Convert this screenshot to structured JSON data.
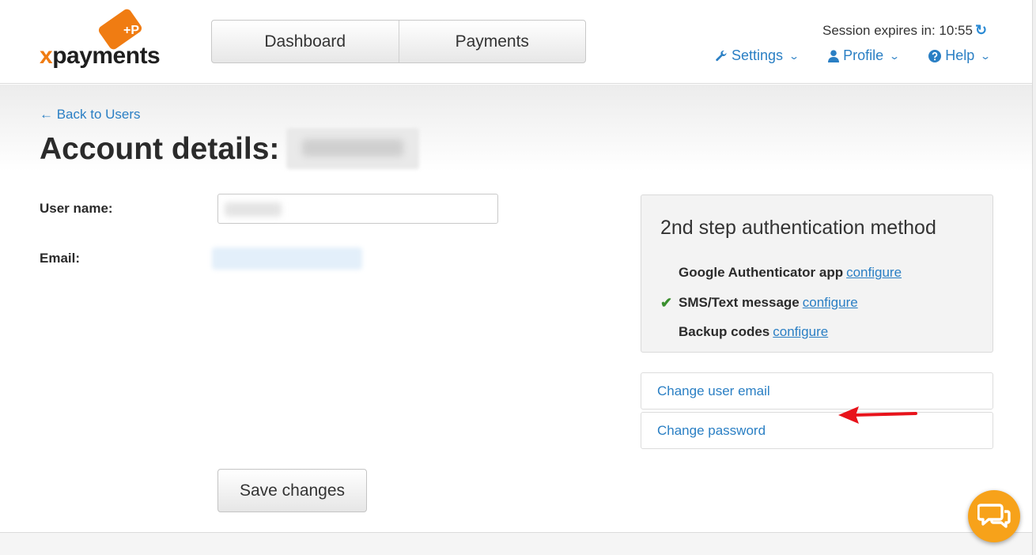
{
  "logo": {
    "text_x": "x",
    "text_rest": "payments",
    "card_mark": "+P"
  },
  "nav": {
    "tabs": [
      {
        "label": "Dashboard"
      },
      {
        "label": "Payments"
      }
    ]
  },
  "session": {
    "label": "Session expires in: 10:55",
    "icon": "refresh-icon"
  },
  "topmenu": {
    "settings": {
      "label": "Settings",
      "icon": "wrench-icon"
    },
    "profile": {
      "label": "Profile",
      "icon": "user-icon"
    },
    "help": {
      "label": "Help",
      "icon": "question-circle-icon"
    }
  },
  "page": {
    "back_link": "← Back to Users",
    "title": "Account details:",
    "fields": {
      "username_label": "User name:",
      "email_label": "Email:"
    },
    "save_label": "Save changes"
  },
  "auth": {
    "title": "2nd step authentication method",
    "methods": [
      {
        "name": "Google Authenticator app",
        "link": "configure",
        "active": false
      },
      {
        "name": "SMS/Text message",
        "link": "configure",
        "active": true
      },
      {
        "name": "Backup codes",
        "link": "configure",
        "active": false
      }
    ]
  },
  "actions": {
    "change_email": "Change user email",
    "change_password": "Change password"
  },
  "colors": {
    "accent": "#2a7fc4",
    "brand": "#f07c12",
    "chat": "#f7a21a",
    "arrow": "#e8131b",
    "check": "#3a8f2e"
  }
}
